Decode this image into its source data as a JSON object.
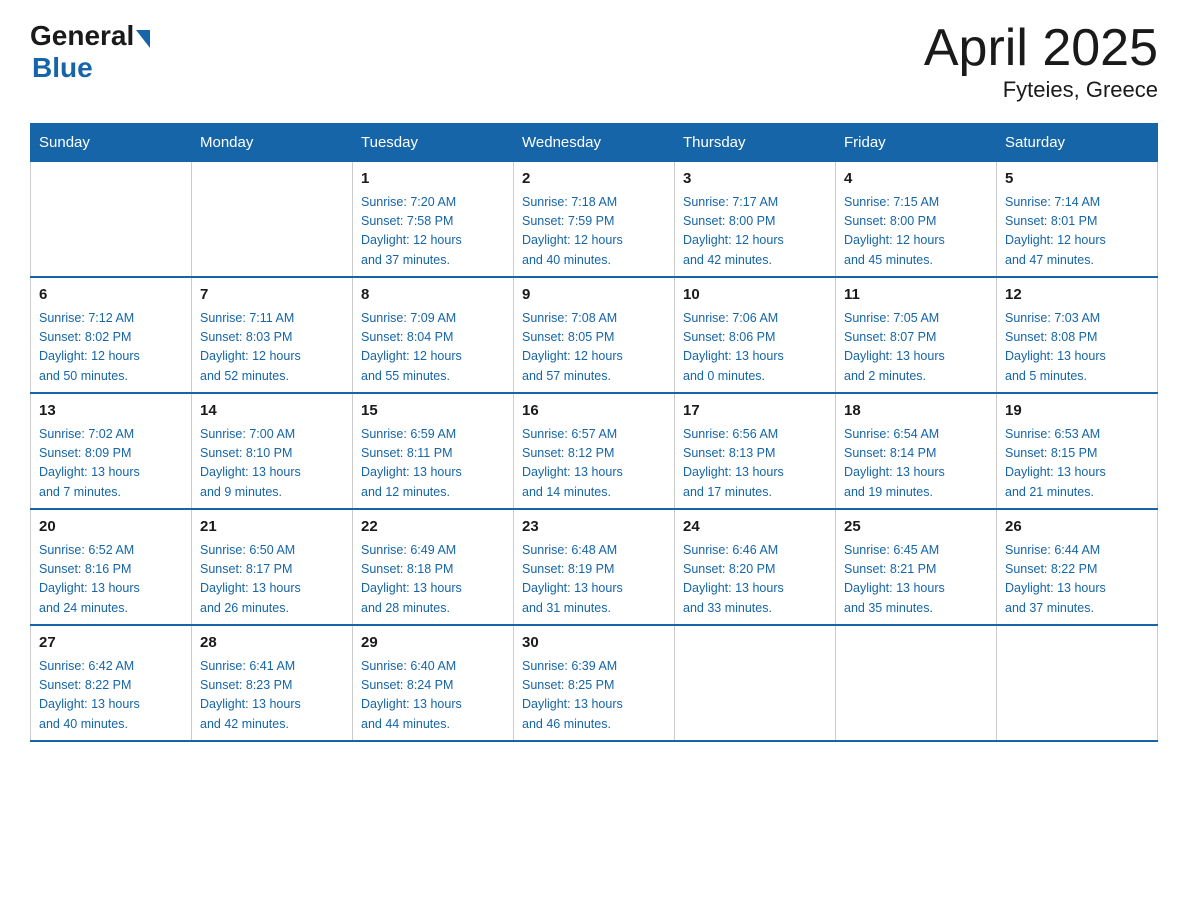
{
  "logo": {
    "text_general": "General",
    "text_blue": "Blue",
    "arrow": true
  },
  "title": "April 2025",
  "subtitle": "Fyteies, Greece",
  "calendar": {
    "headers": [
      "Sunday",
      "Monday",
      "Tuesday",
      "Wednesday",
      "Thursday",
      "Friday",
      "Saturday"
    ],
    "weeks": [
      [
        {
          "day": "",
          "info": ""
        },
        {
          "day": "",
          "info": ""
        },
        {
          "day": "1",
          "info": "Sunrise: 7:20 AM\nSunset: 7:58 PM\nDaylight: 12 hours\nand 37 minutes."
        },
        {
          "day": "2",
          "info": "Sunrise: 7:18 AM\nSunset: 7:59 PM\nDaylight: 12 hours\nand 40 minutes."
        },
        {
          "day": "3",
          "info": "Sunrise: 7:17 AM\nSunset: 8:00 PM\nDaylight: 12 hours\nand 42 minutes."
        },
        {
          "day": "4",
          "info": "Sunrise: 7:15 AM\nSunset: 8:00 PM\nDaylight: 12 hours\nand 45 minutes."
        },
        {
          "day": "5",
          "info": "Sunrise: 7:14 AM\nSunset: 8:01 PM\nDaylight: 12 hours\nand 47 minutes."
        }
      ],
      [
        {
          "day": "6",
          "info": "Sunrise: 7:12 AM\nSunset: 8:02 PM\nDaylight: 12 hours\nand 50 minutes."
        },
        {
          "day": "7",
          "info": "Sunrise: 7:11 AM\nSunset: 8:03 PM\nDaylight: 12 hours\nand 52 minutes."
        },
        {
          "day": "8",
          "info": "Sunrise: 7:09 AM\nSunset: 8:04 PM\nDaylight: 12 hours\nand 55 minutes."
        },
        {
          "day": "9",
          "info": "Sunrise: 7:08 AM\nSunset: 8:05 PM\nDaylight: 12 hours\nand 57 minutes."
        },
        {
          "day": "10",
          "info": "Sunrise: 7:06 AM\nSunset: 8:06 PM\nDaylight: 13 hours\nand 0 minutes."
        },
        {
          "day": "11",
          "info": "Sunrise: 7:05 AM\nSunset: 8:07 PM\nDaylight: 13 hours\nand 2 minutes."
        },
        {
          "day": "12",
          "info": "Sunrise: 7:03 AM\nSunset: 8:08 PM\nDaylight: 13 hours\nand 5 minutes."
        }
      ],
      [
        {
          "day": "13",
          "info": "Sunrise: 7:02 AM\nSunset: 8:09 PM\nDaylight: 13 hours\nand 7 minutes."
        },
        {
          "day": "14",
          "info": "Sunrise: 7:00 AM\nSunset: 8:10 PM\nDaylight: 13 hours\nand 9 minutes."
        },
        {
          "day": "15",
          "info": "Sunrise: 6:59 AM\nSunset: 8:11 PM\nDaylight: 13 hours\nand 12 minutes."
        },
        {
          "day": "16",
          "info": "Sunrise: 6:57 AM\nSunset: 8:12 PM\nDaylight: 13 hours\nand 14 minutes."
        },
        {
          "day": "17",
          "info": "Sunrise: 6:56 AM\nSunset: 8:13 PM\nDaylight: 13 hours\nand 17 minutes."
        },
        {
          "day": "18",
          "info": "Sunrise: 6:54 AM\nSunset: 8:14 PM\nDaylight: 13 hours\nand 19 minutes."
        },
        {
          "day": "19",
          "info": "Sunrise: 6:53 AM\nSunset: 8:15 PM\nDaylight: 13 hours\nand 21 minutes."
        }
      ],
      [
        {
          "day": "20",
          "info": "Sunrise: 6:52 AM\nSunset: 8:16 PM\nDaylight: 13 hours\nand 24 minutes."
        },
        {
          "day": "21",
          "info": "Sunrise: 6:50 AM\nSunset: 8:17 PM\nDaylight: 13 hours\nand 26 minutes."
        },
        {
          "day": "22",
          "info": "Sunrise: 6:49 AM\nSunset: 8:18 PM\nDaylight: 13 hours\nand 28 minutes."
        },
        {
          "day": "23",
          "info": "Sunrise: 6:48 AM\nSunset: 8:19 PM\nDaylight: 13 hours\nand 31 minutes."
        },
        {
          "day": "24",
          "info": "Sunrise: 6:46 AM\nSunset: 8:20 PM\nDaylight: 13 hours\nand 33 minutes."
        },
        {
          "day": "25",
          "info": "Sunrise: 6:45 AM\nSunset: 8:21 PM\nDaylight: 13 hours\nand 35 minutes."
        },
        {
          "day": "26",
          "info": "Sunrise: 6:44 AM\nSunset: 8:22 PM\nDaylight: 13 hours\nand 37 minutes."
        }
      ],
      [
        {
          "day": "27",
          "info": "Sunrise: 6:42 AM\nSunset: 8:22 PM\nDaylight: 13 hours\nand 40 minutes."
        },
        {
          "day": "28",
          "info": "Sunrise: 6:41 AM\nSunset: 8:23 PM\nDaylight: 13 hours\nand 42 minutes."
        },
        {
          "day": "29",
          "info": "Sunrise: 6:40 AM\nSunset: 8:24 PM\nDaylight: 13 hours\nand 44 minutes."
        },
        {
          "day": "30",
          "info": "Sunrise: 6:39 AM\nSunset: 8:25 PM\nDaylight: 13 hours\nand 46 minutes."
        },
        {
          "day": "",
          "info": ""
        },
        {
          "day": "",
          "info": ""
        },
        {
          "day": "",
          "info": ""
        }
      ]
    ]
  }
}
